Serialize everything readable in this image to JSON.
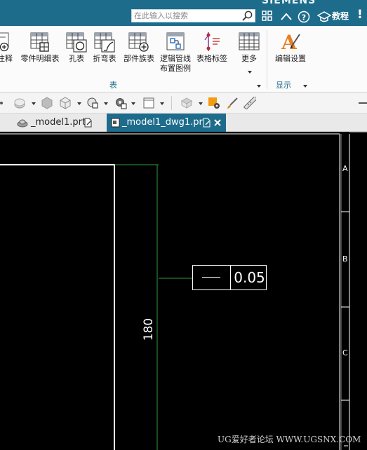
{
  "app": {
    "brand": "SIEMENS"
  },
  "search": {
    "placeholder": "在此输入以搜索"
  },
  "titlebar": {
    "tutorial_label": "教程",
    "help_glyph": "?",
    "alert_glyph": "!"
  },
  "ribbon": {
    "items": [
      {
        "label": "注释",
        "icon": "annotation-icon"
      },
      {
        "label": "零件明细表",
        "icon": "parts-list-icon"
      },
      {
        "label": "孔表",
        "icon": "hole-table-icon"
      },
      {
        "label": "折弯表",
        "icon": "bend-table-icon"
      },
      {
        "label": "部件族表",
        "icon": "part-family-table-icon"
      },
      {
        "label": "逻辑管线布置图例",
        "label_line1": "逻辑管线",
        "label_line2": "布置图例",
        "icon": "logical-routing-legend-icon"
      },
      {
        "label": "表格标签",
        "icon": "tabular-note-icon"
      },
      {
        "label": "更多",
        "icon": "more-icon"
      },
      {
        "label": "编辑设置",
        "icon": "edit-settings-icon"
      }
    ],
    "groups": {
      "table": "表",
      "display": "显示"
    }
  },
  "tabs": [
    {
      "label": "_model1.prt",
      "active": false
    },
    {
      "label": "_model1_dwg1.prt",
      "active": true
    }
  ],
  "drawing": {
    "border_zones": [
      "A",
      "B",
      "C"
    ],
    "fcf_value": "0.05",
    "fcf_symbol": "flatness",
    "dimension_value": "180"
  },
  "watermark": "UG爱好者论坛 WWW.UGSNX.COM",
  "colors": {
    "titlebar": "#1e6c8c",
    "accent": "#1e6c8c",
    "canvas": "#000000",
    "dimension_line": "#2f9c3f"
  }
}
